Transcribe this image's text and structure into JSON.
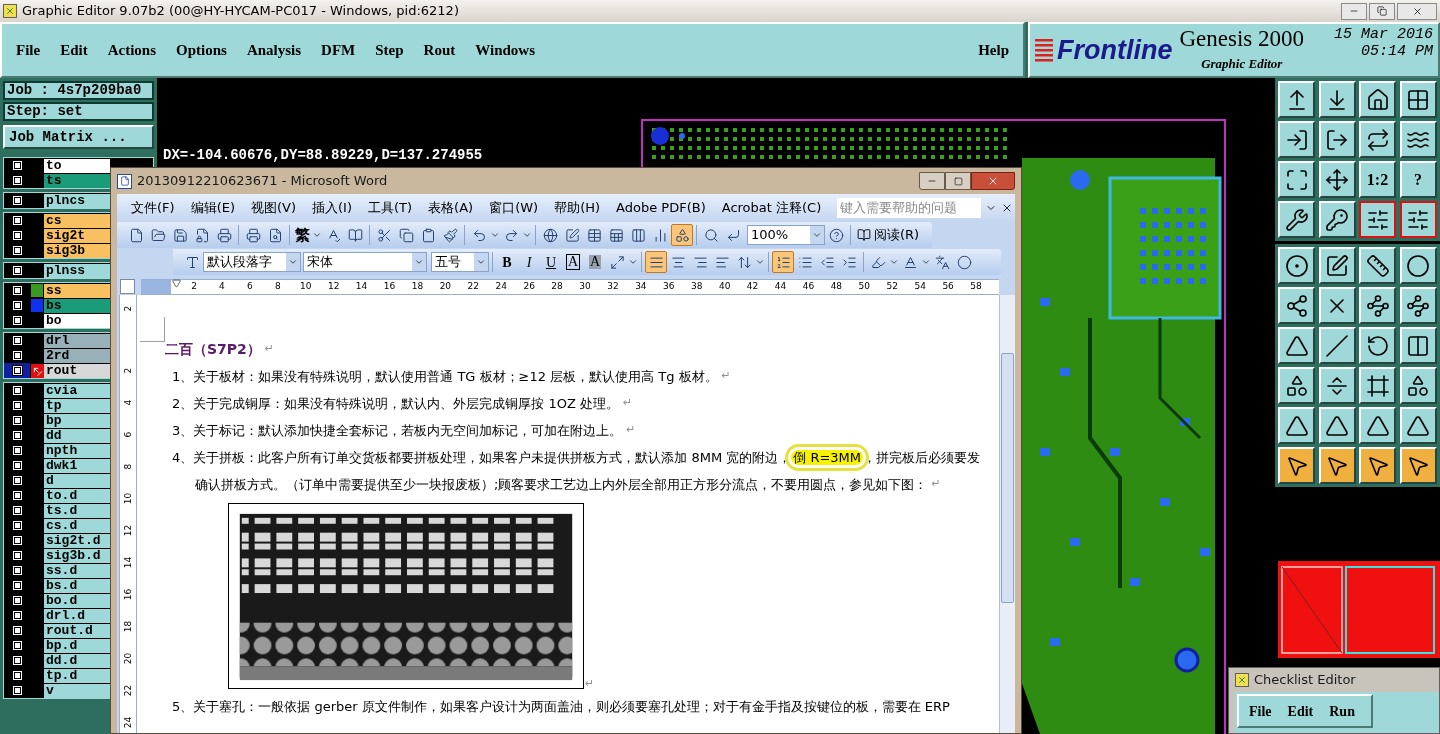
{
  "window": {
    "title": "Graphic Editor 9.07b2 (00@HY-HYCAM-PC017 - Windows, pid:6212)"
  },
  "menu": [
    "File",
    "Edit",
    "Actions",
    "Options",
    "Analysis",
    "DFM",
    "Step",
    "Rout",
    "Windows"
  ],
  "help_menu": "Help",
  "brand": {
    "logo": "Frontline",
    "product": "Genesis 2000",
    "module": "Graphic Editor",
    "date": "15 Mar 2016",
    "time": "05:14 PM"
  },
  "job": {
    "job": "Job : 4s7p209ba0",
    "step": "Step: set",
    "matrix_button": "Job Matrix ..."
  },
  "layer_groups": [
    [
      {
        "name": "to",
        "color": "#ffffff",
        "selected": false
      },
      {
        "name": "ts",
        "color": "#1a9c7a",
        "selected": false
      }
    ],
    [
      {
        "name": "plncs",
        "color": "#9ed8d8",
        "selected": false
      }
    ],
    [
      {
        "name": "cs",
        "color": "#f8c060",
        "selected": false
      },
      {
        "name": "sig2t",
        "color": "#f8c060",
        "selected": false
      },
      {
        "name": "sig3b",
        "color": "#f8c060",
        "selected": false
      }
    ],
    [
      {
        "name": "plnss",
        "color": "#9ed8d8",
        "selected": false
      }
    ],
    [
      {
        "name": "ss",
        "color": "#f8c060",
        "swatch": {
          "color": "#3a9a20"
        },
        "selected": false
      },
      {
        "name": "bs",
        "color": "#1a9c7a",
        "swatch": {
          "color": "#1030f0"
        },
        "selected": false
      },
      {
        "name": "bo",
        "color": "#ffffff",
        "selected": false
      }
    ],
    [
      {
        "name": "drl",
        "color": "#98b0b8",
        "selected": false
      },
      {
        "name": "2rd",
        "color": "#98b0b8",
        "selected": false
      },
      {
        "name": "rout",
        "color": "#d8d8d8",
        "selected": true
      }
    ],
    [
      {
        "name": "cvia",
        "color": "#9ed8d8",
        "selected": false
      },
      {
        "name": "tp",
        "color": "#9ed8d8",
        "selected": false
      },
      {
        "name": "bp",
        "color": "#9ed8d8",
        "selected": false
      },
      {
        "name": "dd",
        "color": "#9ed8d8",
        "selected": false
      },
      {
        "name": "npth",
        "color": "#9ed8d8",
        "selected": false
      },
      {
        "name": "dwk1",
        "color": "#9ed8d8",
        "selected": false
      },
      {
        "name": "d",
        "color": "#9ed8d8",
        "selected": false
      },
      {
        "name": "to.d",
        "color": "#9ed8d8",
        "selected": false
      },
      {
        "name": "ts.d",
        "color": "#9ed8d8",
        "selected": false
      },
      {
        "name": "cs.d",
        "color": "#9ed8d8",
        "selected": false
      },
      {
        "name": "sig2t.d",
        "color": "#9ed8d8",
        "selected": false
      },
      {
        "name": "sig3b.d",
        "color": "#9ed8d8",
        "selected": false
      },
      {
        "name": "ss.d",
        "color": "#9ed8d8",
        "selected": false
      },
      {
        "name": "bs.d",
        "color": "#9ed8d8",
        "selected": false
      },
      {
        "name": "bo.d",
        "color": "#9ed8d8",
        "selected": false
      },
      {
        "name": "drl.d",
        "color": "#9ed8d8",
        "selected": false
      },
      {
        "name": "rout.d",
        "color": "#9ed8d8",
        "selected": false
      },
      {
        "name": "bp.d",
        "color": "#9ed8d8",
        "selected": false
      },
      {
        "name": "dd.d",
        "color": "#9ed8d8",
        "selected": false
      },
      {
        "name": "tp.d",
        "color": "#9ed8d8",
        "selected": false
      },
      {
        "name": "v",
        "color": "#9ed8d8",
        "selected": false
      }
    ]
  ],
  "measurement": "DX=-104.60676,DY=88.89229,D=137.274955",
  "tools": [
    {
      "kind": "tray-up",
      "selected": false
    },
    {
      "kind": "tray-down",
      "selected": false
    },
    {
      "kind": "home",
      "selected": false
    },
    {
      "kind": "grid",
      "selected": false
    },
    {
      "kind": "enter",
      "selected": false
    },
    {
      "kind": "exit",
      "selected": false
    },
    {
      "kind": "swap",
      "selected": false
    },
    {
      "kind": "wave",
      "selected": false
    },
    {
      "kind": "expand",
      "selected": false
    },
    {
      "kind": "move",
      "selected": false
    },
    {
      "kind": "text",
      "label": "1:2",
      "selected": false
    },
    {
      "kind": "text",
      "label": "?",
      "selected": false
    },
    {
      "kind": "wrench",
      "selected": false
    },
    {
      "kind": "key",
      "selected": false
    },
    {
      "kind": "sliders",
      "selected": true
    },
    {
      "kind": "sliders",
      "selected": true
    },
    {
      "kind": "circle-dot",
      "selected": false
    },
    {
      "kind": "pen",
      "selected": false
    },
    {
      "kind": "ruler",
      "selected": false
    },
    {
      "kind": "circle",
      "selected": false
    },
    {
      "kind": "nodes",
      "selected": false
    },
    {
      "kind": "cross",
      "selected": false
    },
    {
      "kind": "line-dot",
      "selected": false
    },
    {
      "kind": "line-dot",
      "selected": false
    },
    {
      "kind": "triangle",
      "selected": false
    },
    {
      "kind": "slash",
      "selected": false
    },
    {
      "kind": "rotate",
      "selected": false
    },
    {
      "kind": "columns",
      "selected": false
    },
    {
      "kind": "shapes",
      "selected": false
    },
    {
      "kind": "minus",
      "selected": false
    },
    {
      "kind": "frame",
      "selected": false
    },
    {
      "kind": "shapes",
      "selected": false
    },
    {
      "kind": "triangle",
      "selected": false
    },
    {
      "kind": "triangle",
      "selected": false
    },
    {
      "kind": "triangle",
      "selected": false
    },
    {
      "kind": "triangle",
      "selected": false
    },
    {
      "kind": "pointer",
      "selected": false
    },
    {
      "kind": "pointer",
      "selected": false
    },
    {
      "kind": "pointer",
      "selected": false
    },
    {
      "kind": "pointer",
      "selected": false
    }
  ],
  "word": {
    "title": "20130912210623671 - Microsoft Word",
    "menu": [
      "文件(F)",
      "编辑(E)",
      "视图(V)",
      "插入(I)",
      "工具(T)",
      "表格(A)",
      "窗口(W)",
      "帮助(H)",
      "Adobe PDF(B)",
      "Acrobat 注释(C)"
    ],
    "help_placeholder": "键入需要帮助的问题",
    "traditional": "繁",
    "zoom": "100%",
    "read_button": "阅读(R)",
    "drawing_on": true,
    "style": "默认段落字",
    "font": "宋体",
    "size": "五号",
    "format_buttons": [
      {
        "label": "B",
        "kind": "bold"
      },
      {
        "label": "I",
        "kind": "italic"
      },
      {
        "label": "U",
        "kind": "underline"
      },
      {
        "label": "A",
        "kind": "border"
      },
      {
        "label": "A",
        "kind": "shading"
      }
    ],
    "alignment": [
      {
        "kind": "justify",
        "selected": true
      },
      {
        "kind": "center",
        "selected": false
      },
      {
        "kind": "right",
        "selected": false
      },
      {
        "kind": "distributed",
        "selected": false
      }
    ],
    "lists": [
      {
        "kind": "numbered",
        "selected": true
      },
      {
        "kind": "bulleted",
        "selected": false
      }
    ],
    "ruler": [
      "2",
      "4",
      "6",
      "8",
      "10",
      "12",
      "14",
      "16",
      "18",
      "20",
      "22",
      "24",
      "26",
      "28",
      "30",
      "32",
      "34",
      "36",
      "38",
      "40",
      "42",
      "44",
      "46",
      "48",
      "50",
      "52",
      "54",
      "56",
      "58"
    ],
    "vruler": [
      "2",
      "2",
      "4",
      "6",
      "8",
      "10",
      "12",
      "14",
      "16",
      "18",
      "20",
      "22",
      "24"
    ],
    "heading": "二百（S7P2）",
    "heading_mark": "↵",
    "paragraphs": [
      {
        "lines": [
          {
            "text": "1、关于板材：如果没有特殊说明，默认使用普通 TG 板材；≥12 层板，默认使用高 Tg 板材。",
            "mark": "↵"
          }
        ]
      },
      {
        "lines": [
          {
            "text": "2、关于完成铜厚：如果没有特殊说明，默认内、外层完成铜厚按 1OZ 处理。",
            "mark": "↵"
          }
        ]
      },
      {
        "lines": [
          {
            "text": "3、关于标记：默认添加快捷全套标记，若板内无空间加标记，可加在附边上。",
            "mark": "↵"
          }
        ]
      },
      {
        "lines": [
          {
            "text": "4、关于拼板：此客户所有订单交货板都要拼板处理，如果客户未提供拼板方式，默认添加 8MM 宽的附边，",
            "highlight": "倒 R=3MM",
            "after": "，拼完板后必须要发"
          },
          {
            "text": "确认拼板方式。（订单中需要提供至少一块报废板）;顾客要求工艺边上内外层全部用正方形分流点，不要用圆点，参见如下图：",
            "mark": "↵"
          }
        ]
      }
    ],
    "image_mark": "↵",
    "last_paragraph": "5、关于塞孔：一般依据 gerber 原文件制作，如果客户设计为两面盖油，则必须要塞孔处理；对于有金手指及按键位的板，需要在 ERP"
  },
  "checklist": {
    "title": "Checklist Editor",
    "menu": [
      "File",
      "Edit",
      "Run"
    ]
  }
}
